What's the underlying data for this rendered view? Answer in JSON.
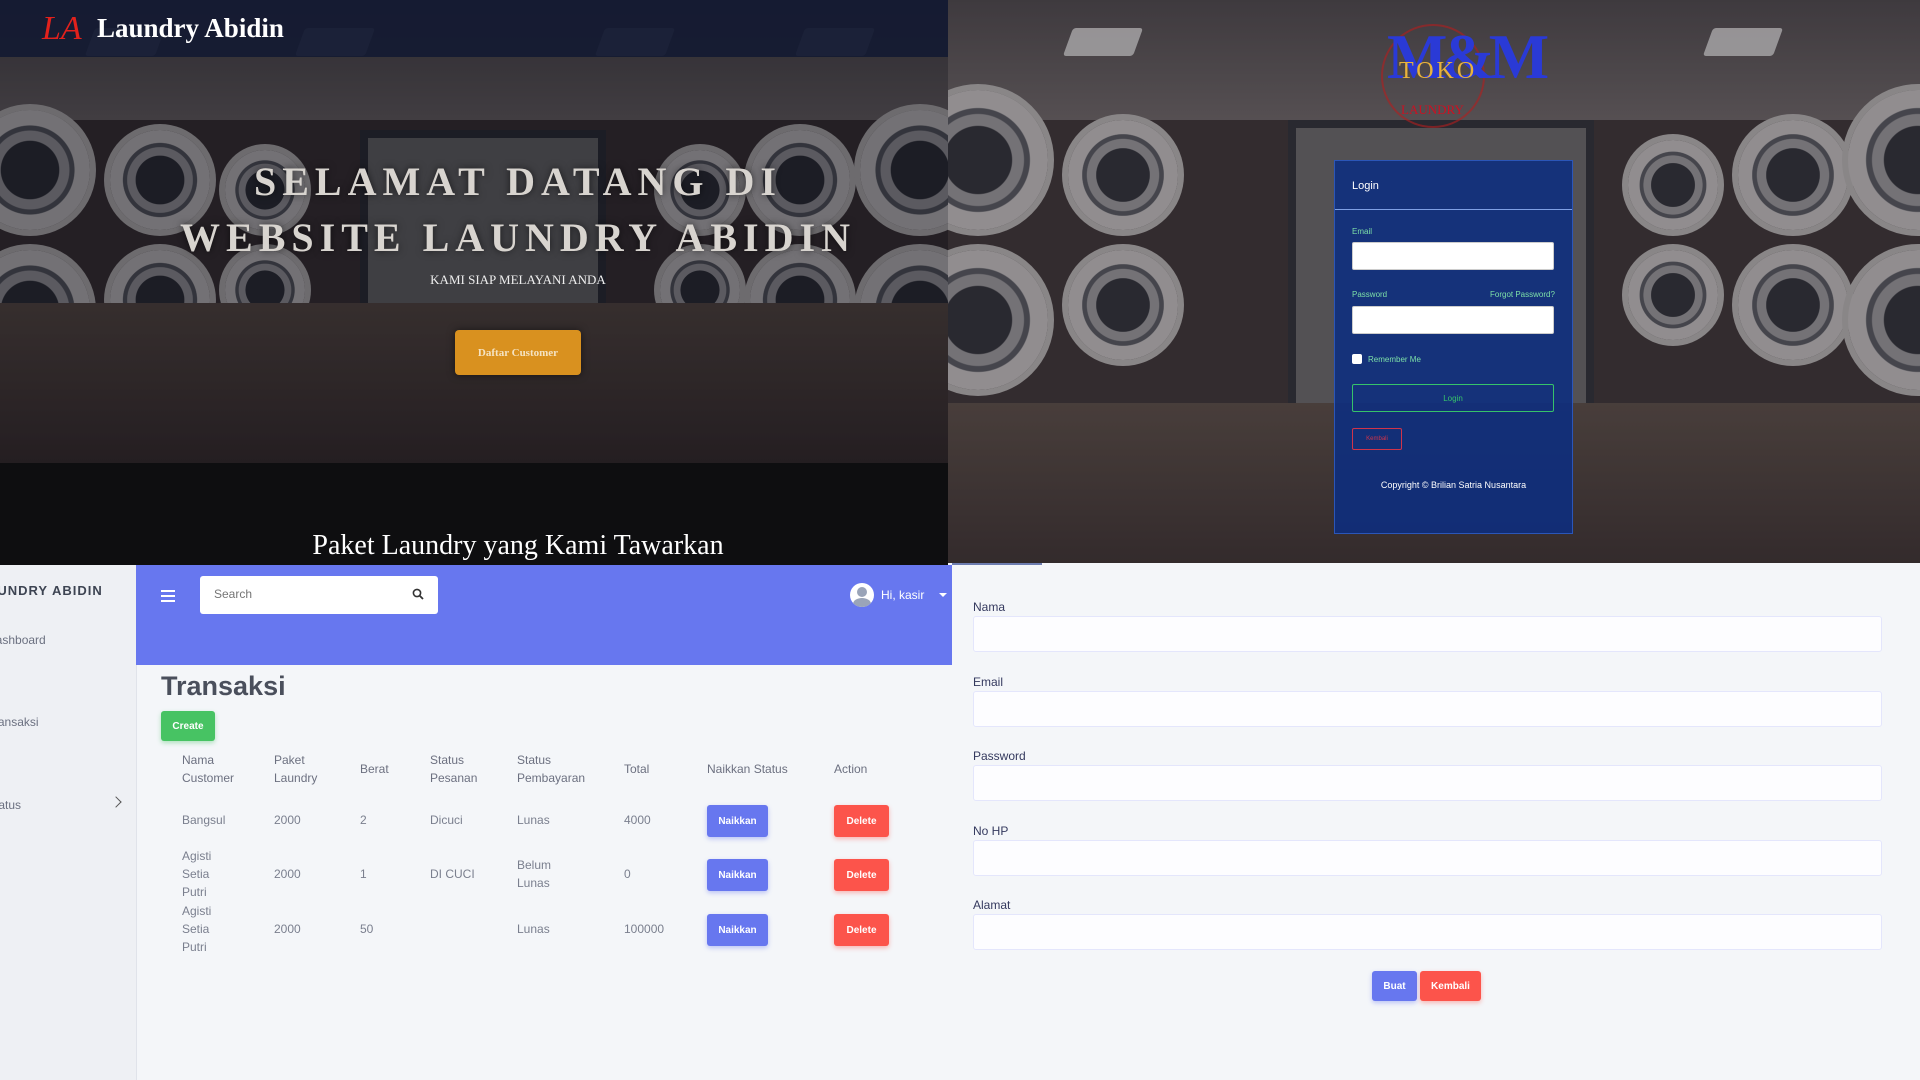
{
  "landing": {
    "brand_logo": "LA",
    "brand_title": "Laundry Abidin",
    "hero_line1": "SELAMAT DATANG DI",
    "hero_line2": "WEBSITE LAUNDRY ABIDIN",
    "hero_sub": "KAMI SIAP MELAYANI ANDA",
    "cta_label": "Daftar Customer",
    "section_title": "Paket Laundry yang Kami Tawarkan"
  },
  "login": {
    "logo_mm": "M&M",
    "logo_toko": "TOKO",
    "logo_laundry": "LAUNDRY",
    "card_title": "Login",
    "email_label": "Email",
    "password_label": "Password",
    "forgot_label": "Forgot Password?",
    "remember_label": "Remember Me",
    "login_button": "Login",
    "back_button": "Kembali",
    "copyright": "Copyright © Brilian Satria Nusantara"
  },
  "admin": {
    "brand": "LAUNDRY ABIDIN",
    "sidebar_items": [
      "Dashboard",
      "Transaksi",
      "Status"
    ],
    "search_placeholder": "Search",
    "user_greeting": "Hi, kasir",
    "page_title": "Transaksi",
    "create_label": "Create",
    "columns": [
      "Nama Customer",
      "Paket Laundry",
      "Berat",
      "Status Pesanan",
      "Status Pembayaran",
      "Total",
      "Naikkan Status",
      "Action"
    ],
    "rows": [
      {
        "nama": "Bangsul",
        "paket": "2000",
        "berat": "2",
        "status_pesanan": "Dicuci",
        "status_pembayaran": "Lunas",
        "total": "4000"
      },
      {
        "nama": "Agisti Setia Putri",
        "paket": "2000",
        "berat": "1",
        "status_pesanan": "DI CUCI",
        "status_pembayaran": "Belum Lunas",
        "total": "0"
      },
      {
        "nama": "Agisti Setia Putri",
        "paket": "2000",
        "berat": "50",
        "status_pesanan": "",
        "status_pembayaran": "Lunas",
        "total": "100000"
      }
    ],
    "naikkan_label": "Naikkan",
    "delete_label": "Delete"
  },
  "form": {
    "fields": [
      "Nama",
      "Email",
      "Password",
      "No HP",
      "Alamat"
    ],
    "submit_label": "Buat",
    "back_label": "Kembali"
  },
  "colors": {
    "primary": "#6777ef",
    "success": "#47c363",
    "danger": "#fc544b",
    "landing_cta": "#d9911f",
    "login_card": "#0c2e80"
  },
  "icons": {
    "search": "search-icon",
    "menu": "hamburger-icon",
    "user": "avatar-icon",
    "sidebar_expand": "chevron-right-icon"
  }
}
